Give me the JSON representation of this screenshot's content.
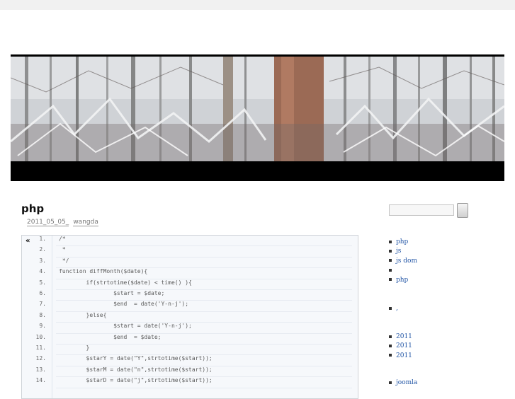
{
  "post": {
    "title": "php",
    "date": "2011_05_05_",
    "author": "wangda"
  },
  "code": {
    "fold_label": "«",
    "lines": [
      {
        "n": "1.",
        "text": "/*"
      },
      {
        "n": "2.",
        "text": " *"
      },
      {
        "n": "3.",
        "text": " */"
      },
      {
        "n": "4.",
        "text": "function diffMonth($date){"
      },
      {
        "n": "5.",
        "text": "        if(strtotime($date) < time() ){"
      },
      {
        "n": "6.",
        "text": "                $start = $date;"
      },
      {
        "n": "7.",
        "text": "                $end  = date('Y-n-j');"
      },
      {
        "n": "8.",
        "text": "        }else{"
      },
      {
        "n": "9.",
        "text": "                $start = date('Y-n-j');"
      },
      {
        "n": "10.",
        "text": "                $end  = $date;"
      },
      {
        "n": "11.",
        "text": "        }"
      },
      {
        "n": "12.",
        "text": "        $starY = date(\"Y\",strtotime($start));"
      },
      {
        "n": "13.",
        "text": "        $starM = date(\"n\",strtotime($start));"
      },
      {
        "n": "14.",
        "text": "        $starD = date(\"j\",strtotime($start));"
      }
    ]
  },
  "sidebar": {
    "search_button_label": "",
    "categories": [
      "php",
      "js",
      "js  dom",
      "",
      "php"
    ],
    "misc": [
      ","
    ],
    "archives": [
      "2011",
      "2011",
      "2011"
    ],
    "links": [
      "joomla"
    ]
  },
  "colors": {
    "link": "#2356a6",
    "header_bg": "#000000",
    "code_bg": "#f6f8fb"
  }
}
